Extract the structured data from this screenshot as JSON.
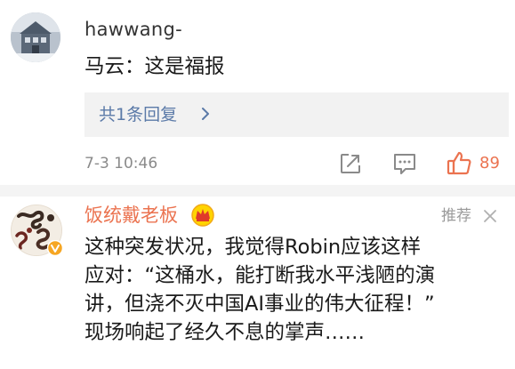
{
  "comments": [
    {
      "username": "hawwang-",
      "text": "马云：这是福报",
      "reply_summary": "共1条回复",
      "timestamp": "7-3 10:46",
      "like_count": "89",
      "icons": [
        "avatar-photo",
        "share-icon",
        "comment-icon",
        "thumbs-up-icon",
        "chevron-right-icon"
      ],
      "colors": {
        "like": "#eb7350",
        "reply_link": "#5b7aa8"
      }
    },
    {
      "username": "饭统戴老板",
      "badge": "crown-vip-icon",
      "recommend_label": "推荐",
      "lines": [
        "这种突发状况，我觉得Robin应该这样",
        "应对：“这桶水，能打断我水平浅陋的演",
        "讲，但浇不灭中国AI事业的伟大征程！”",
        "现场响起了经久不息的掌声……"
      ],
      "icons": [
        "avatar-photo",
        "verified-v-icon",
        "close-icon"
      ],
      "colors": {
        "username": "#eb7350"
      }
    }
  ]
}
